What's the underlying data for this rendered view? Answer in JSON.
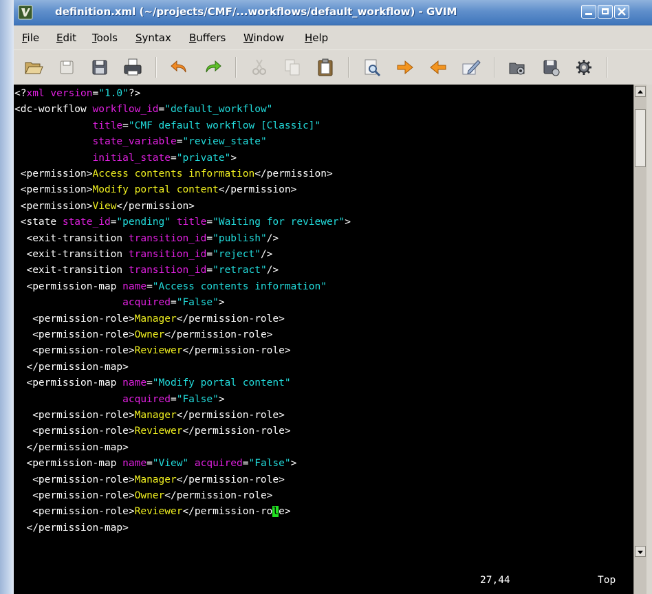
{
  "window": {
    "title": "definition.xml (~/projects/CMF/...workflows/default_workflow) - GVIM"
  },
  "menu": [
    {
      "label": "File",
      "accel": "F",
      "rest": "ile"
    },
    {
      "label": "Edit",
      "accel": "E",
      "rest": "dit"
    },
    {
      "label": "Tools",
      "accel": "T",
      "rest": "ools"
    },
    {
      "label": "Syntax",
      "accel": "S",
      "rest": "yntax"
    },
    {
      "label": "Buffers",
      "accel": "B",
      "rest": "uffers"
    },
    {
      "label": "Window",
      "accel": "W",
      "rest": "indow"
    },
    {
      "label": "Help",
      "accel": "H",
      "rest": "elp"
    }
  ],
  "toolbar": [
    {
      "name": "open-icon"
    },
    {
      "name": "save-icon"
    },
    {
      "name": "save-all-icon"
    },
    {
      "name": "print-icon"
    },
    {
      "name": "undo-icon"
    },
    {
      "name": "redo-icon"
    },
    {
      "name": "cut-icon"
    },
    {
      "name": "copy-icon"
    },
    {
      "name": "paste-icon"
    },
    {
      "name": "find-icon"
    },
    {
      "name": "find-next-icon"
    },
    {
      "name": "find-previous-icon"
    },
    {
      "name": "load-session-icon"
    },
    {
      "name": "make-icon"
    },
    {
      "name": "save-session-icon"
    },
    {
      "name": "run-script-icon"
    }
  ],
  "editor": {
    "lines": [
      [
        [
          "t",
          "<?"
        ],
        [
          "a",
          "xml version"
        ],
        [
          "t",
          "="
        ],
        [
          "v",
          "\"1.0\""
        ],
        [
          "t",
          "?>"
        ]
      ],
      [
        [
          "t",
          "<dc-workflow "
        ],
        [
          "a",
          "workflow_id"
        ],
        [
          "t",
          "="
        ],
        [
          "v",
          "\"default_workflow\""
        ]
      ],
      [
        [
          "t",
          "             "
        ],
        [
          "a",
          "title"
        ],
        [
          "t",
          "="
        ],
        [
          "v",
          "\"CMF default workflow [Classic]\""
        ]
      ],
      [
        [
          "t",
          "             "
        ],
        [
          "a",
          "state_variable"
        ],
        [
          "t",
          "="
        ],
        [
          "v",
          "\"review_state\""
        ]
      ],
      [
        [
          "t",
          "             "
        ],
        [
          "a",
          "initial_state"
        ],
        [
          "t",
          "="
        ],
        [
          "v",
          "\"private\""
        ],
        [
          "t",
          ">"
        ]
      ],
      [
        [
          "t",
          " <permission>"
        ],
        [
          "c",
          "Access contents information"
        ],
        [
          "t",
          "</permission>"
        ]
      ],
      [
        [
          "t",
          " <permission>"
        ],
        [
          "c",
          "Modify portal content"
        ],
        [
          "t",
          "</permission>"
        ]
      ],
      [
        [
          "t",
          " <permission>"
        ],
        [
          "c",
          "View"
        ],
        [
          "t",
          "</permission>"
        ]
      ],
      [
        [
          "t",
          " <state "
        ],
        [
          "a",
          "state_id"
        ],
        [
          "t",
          "="
        ],
        [
          "v",
          "\"pending\""
        ],
        [
          "t",
          " "
        ],
        [
          "a",
          "title"
        ],
        [
          "t",
          "="
        ],
        [
          "v",
          "\"Waiting for reviewer\""
        ],
        [
          "t",
          ">"
        ]
      ],
      [
        [
          "t",
          "  <exit-transition "
        ],
        [
          "a",
          "transition_id"
        ],
        [
          "t",
          "="
        ],
        [
          "v",
          "\"publish\""
        ],
        [
          "t",
          "/>"
        ]
      ],
      [
        [
          "t",
          "  <exit-transition "
        ],
        [
          "a",
          "transition_id"
        ],
        [
          "t",
          "="
        ],
        [
          "v",
          "\"reject\""
        ],
        [
          "t",
          "/>"
        ]
      ],
      [
        [
          "t",
          "  <exit-transition "
        ],
        [
          "a",
          "transition_id"
        ],
        [
          "t",
          "="
        ],
        [
          "v",
          "\"retract\""
        ],
        [
          "t",
          "/>"
        ]
      ],
      [
        [
          "t",
          "  <permission-map "
        ],
        [
          "a",
          "name"
        ],
        [
          "t",
          "="
        ],
        [
          "v",
          "\"Access contents information\""
        ]
      ],
      [
        [
          "t",
          "                  "
        ],
        [
          "a",
          "acquired"
        ],
        [
          "t",
          "="
        ],
        [
          "v",
          "\"False\""
        ],
        [
          "t",
          ">"
        ]
      ],
      [
        [
          "t",
          "   <permission-role>"
        ],
        [
          "c",
          "Manager"
        ],
        [
          "t",
          "</permission-role>"
        ]
      ],
      [
        [
          "t",
          "   <permission-role>"
        ],
        [
          "c",
          "Owner"
        ],
        [
          "t",
          "</permission-role>"
        ]
      ],
      [
        [
          "t",
          "   <permission-role>"
        ],
        [
          "c",
          "Reviewer"
        ],
        [
          "t",
          "</permission-role>"
        ]
      ],
      [
        [
          "t",
          "  </permission-map>"
        ]
      ],
      [
        [
          "t",
          "  <permission-map "
        ],
        [
          "a",
          "name"
        ],
        [
          "t",
          "="
        ],
        [
          "v",
          "\"Modify portal content\""
        ]
      ],
      [
        [
          "t",
          "                  "
        ],
        [
          "a",
          "acquired"
        ],
        [
          "t",
          "="
        ],
        [
          "v",
          "\"False\""
        ],
        [
          "t",
          ">"
        ]
      ],
      [
        [
          "t",
          "   <permission-role>"
        ],
        [
          "c",
          "Manager"
        ],
        [
          "t",
          "</permission-role>"
        ]
      ],
      [
        [
          "t",
          "   <permission-role>"
        ],
        [
          "c",
          "Reviewer"
        ],
        [
          "t",
          "</permission-role>"
        ]
      ],
      [
        [
          "t",
          "  </permission-map>"
        ]
      ],
      [
        [
          "t",
          "  <permission-map "
        ],
        [
          "a",
          "name"
        ],
        [
          "t",
          "="
        ],
        [
          "v",
          "\"View\""
        ],
        [
          "t",
          " "
        ],
        [
          "a",
          "acquired"
        ],
        [
          "t",
          "="
        ],
        [
          "v",
          "\"False\""
        ],
        [
          "t",
          ">"
        ]
      ],
      [
        [
          "t",
          "   <permission-role>"
        ],
        [
          "c",
          "Manager"
        ],
        [
          "t",
          "</permission-role>"
        ]
      ],
      [
        [
          "t",
          "   <permission-role>"
        ],
        [
          "c",
          "Owner"
        ],
        [
          "t",
          "</permission-role>"
        ]
      ],
      [
        [
          "t",
          "   <permission-role>"
        ],
        [
          "c",
          "Reviewer"
        ],
        [
          "t",
          "</permission-ro"
        ],
        [
          "cursor",
          "l"
        ],
        [
          "t",
          "e>"
        ]
      ],
      [
        [
          "t",
          "  </permission-map>"
        ]
      ]
    ],
    "status": {
      "position": "27,44",
      "scroll": "Top"
    }
  },
  "colors": {
    "tag": "#ffffff",
    "attribute": "#e020e0",
    "value": "#22dcdc",
    "content": "#f0f020",
    "cursor": "#21e221",
    "background": "#000000"
  }
}
